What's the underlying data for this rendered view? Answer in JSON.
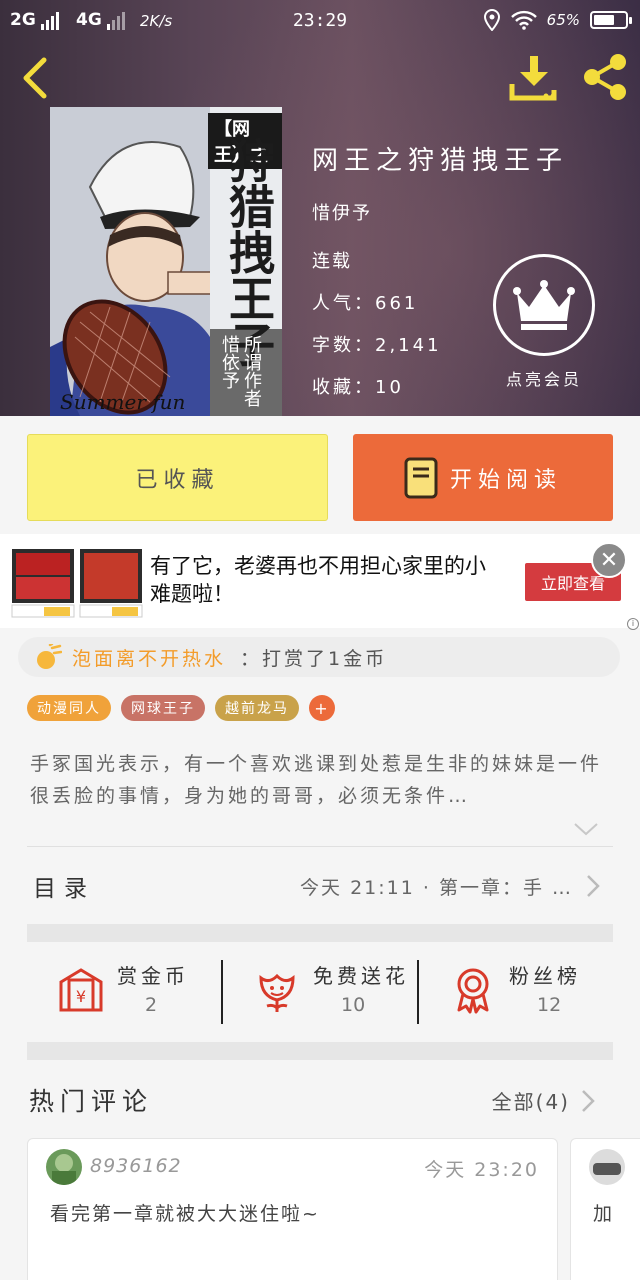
{
  "status_bar": {
    "network_1": "2G",
    "network_2": "4G",
    "speed": "2K/s",
    "time": "23:29",
    "battery": "65%",
    "battery_level": 0.65
  },
  "book": {
    "title": "网王之狩猎拽王子",
    "author": "惜伊予",
    "status": "连载",
    "popularity_label": "人气：",
    "popularity_value": "661",
    "words_label": "字数：",
    "words_value": "2,141",
    "favorites_label": "收藏：",
    "favorites_value": "10"
  },
  "cover": {
    "tag": "【网王】之",
    "title": "狩猎拽王子",
    "subtitle": "所谓作者 惜依予",
    "footer": "Summer fun"
  },
  "vip": {
    "label": "点亮会员"
  },
  "buttons": {
    "favorited": "已收藏",
    "start_reading": "开始阅读"
  },
  "ad": {
    "text": "有了它，老婆再也不用担心家里的小难题啦！",
    "cta": "立即查看",
    "close": "✕"
  },
  "reward": {
    "user": "泡面离不开热水",
    "action": "：打赏了1金币"
  },
  "tags": [
    {
      "label": "动漫同人",
      "color": "#f0a23a"
    },
    {
      "label": "网球王子",
      "color": "#c87366"
    },
    {
      "label": "越前龙马",
      "color": "#c9a24a"
    }
  ],
  "tag_add": "+",
  "description": "手冢国光表示，有一个喜欢逃课到处惹是生非的妹妹是一件很丢脸的事情，身为她的哥哥，必须无条件…",
  "toc": {
    "label": "目录",
    "latest": "今天 21:11 · 第一章：手 …"
  },
  "actions": [
    {
      "title": "赏金币",
      "count": "2",
      "icon": "gold-envelope-icon"
    },
    {
      "title": "免费送花",
      "count": "10",
      "icon": "flower-icon"
    },
    {
      "title": "粉丝榜",
      "count": "12",
      "icon": "medal-icon"
    }
  ],
  "hot_comments": {
    "title": "热门评论",
    "all": "全部(4)"
  },
  "comments": [
    {
      "user": "8936162",
      "time": "今天 23:20",
      "text": "看完第一章就被大大迷住啦~"
    },
    {
      "user": "",
      "time": "",
      "text": "加"
    }
  ],
  "colors": {
    "accent_orange": "#ec6a3a",
    "fav_yellow": "#fbf27a",
    "reward_orange": "#f39c2a",
    "icon_red": "#d83a2a"
  }
}
